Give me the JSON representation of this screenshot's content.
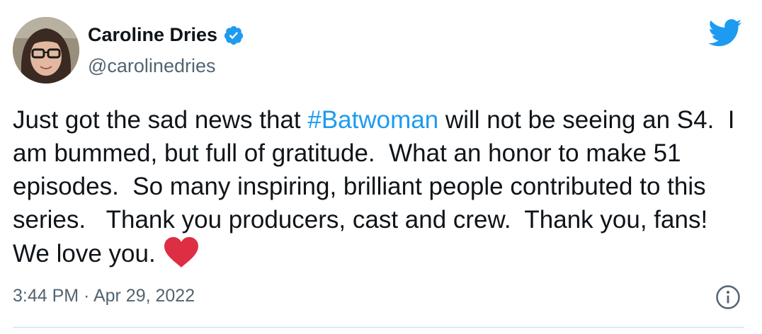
{
  "author": {
    "name": "Caroline Dries",
    "handle": "@carolinedries",
    "verified": true
  },
  "tweet": {
    "text_before_hashtag": "Just got the sad news that ",
    "hashtag": "#Batwoman",
    "text_after_hashtag": " will not be seeing an S4.  I am bummed, but full of gratitude.  What an honor to make 51 episodes.  So many inspiring, brilliant people contributed to this series.   Thank you producers, cast and crew.  Thank you, fans!  We love you.",
    "emoji": "red-heart"
  },
  "meta": {
    "timestamp": "3:44 PM · Apr 29, 2022"
  },
  "icons": {
    "bird": "twitter-bird-icon",
    "info": "info-icon",
    "verified": "verified-badge-icon"
  },
  "colors": {
    "brand": "#1d9bf0",
    "text": "#0f1419",
    "secondary": "#536471",
    "heart": "#e0245e"
  }
}
